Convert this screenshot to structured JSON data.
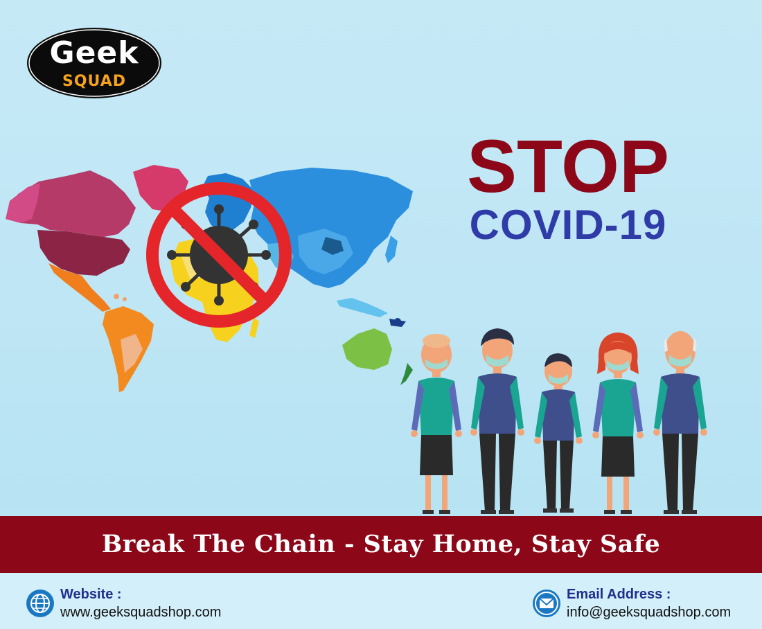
{
  "logo": {
    "line1": "Geek",
    "line2": "SQUAD"
  },
  "headline": {
    "stop": "STOP",
    "virus": "COVID-19"
  },
  "banner": {
    "text": "Break The Chain - Stay Home, Stay Safe"
  },
  "contacts": {
    "website": {
      "label": "Website :",
      "value": "www.geeksquadshop.com",
      "icon": "globe-icon"
    },
    "email": {
      "label": "Email Address :",
      "value": "info@geeksquadshop.com",
      "icon": "envelope-icon"
    }
  },
  "graphics": {
    "map": "world-map",
    "prohibition": "no-virus-sign-icon",
    "people": [
      "person-woman-bald",
      "person-man",
      "person-boy",
      "person-woman-redhair",
      "person-old-man"
    ]
  },
  "colors": {
    "brand_red": "#8c0717",
    "brand_blue": "#2f3ca8",
    "logo_orange": "#f6a31b",
    "sign_red": "#e4262a",
    "background": "#c0e6f5"
  }
}
